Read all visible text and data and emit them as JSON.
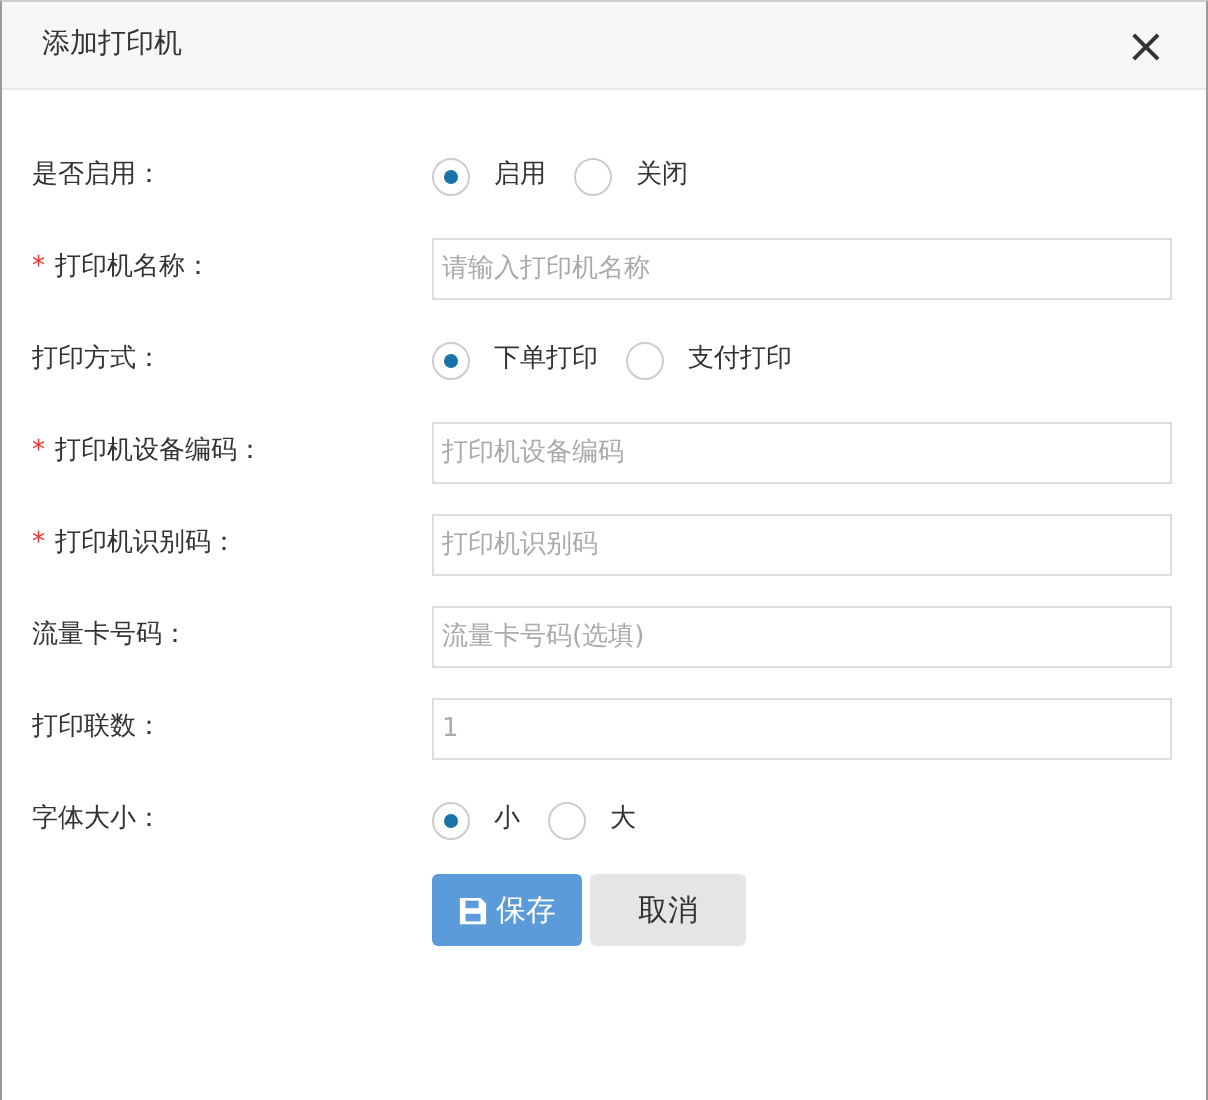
{
  "dialog": {
    "title": "添加打印机",
    "close": "×"
  },
  "fields": [
    {
      "kind": "radio",
      "label": "是否启用：",
      "options": [
        {
          "label": "启用",
          "selected": true
        },
        {
          "label": "关闭",
          "selected": false
        }
      ]
    },
    {
      "kind": "input",
      "required_mark": "*",
      "label": "打印机名称：",
      "placeholder": "请输入打印机名称"
    },
    {
      "kind": "radio",
      "label": "打印方式：",
      "options": [
        {
          "label": "下单打印",
          "selected": true
        },
        {
          "label": "支付打印",
          "selected": false
        }
      ]
    },
    {
      "kind": "input",
      "required_mark": "*",
      "label": "打印机设备编码：",
      "placeholder": "打印机设备编码"
    },
    {
      "kind": "input",
      "required_mark": "*",
      "label": "打印机识别码：",
      "placeholder": "打印机识别码"
    },
    {
      "kind": "input",
      "label": "流量卡号码：",
      "placeholder": "流量卡号码(选填)"
    },
    {
      "kind": "input",
      "label": "打印联数：",
      "placeholder": "1"
    },
    {
      "kind": "radio",
      "label": "字体大小：",
      "options": [
        {
          "label": "小",
          "selected": true
        },
        {
          "label": "大",
          "selected": false
        }
      ]
    }
  ],
  "buttons": [
    {
      "kind": "primary",
      "label": "保存"
    },
    {
      "kind": "secondary",
      "label": "取消"
    }
  ]
}
